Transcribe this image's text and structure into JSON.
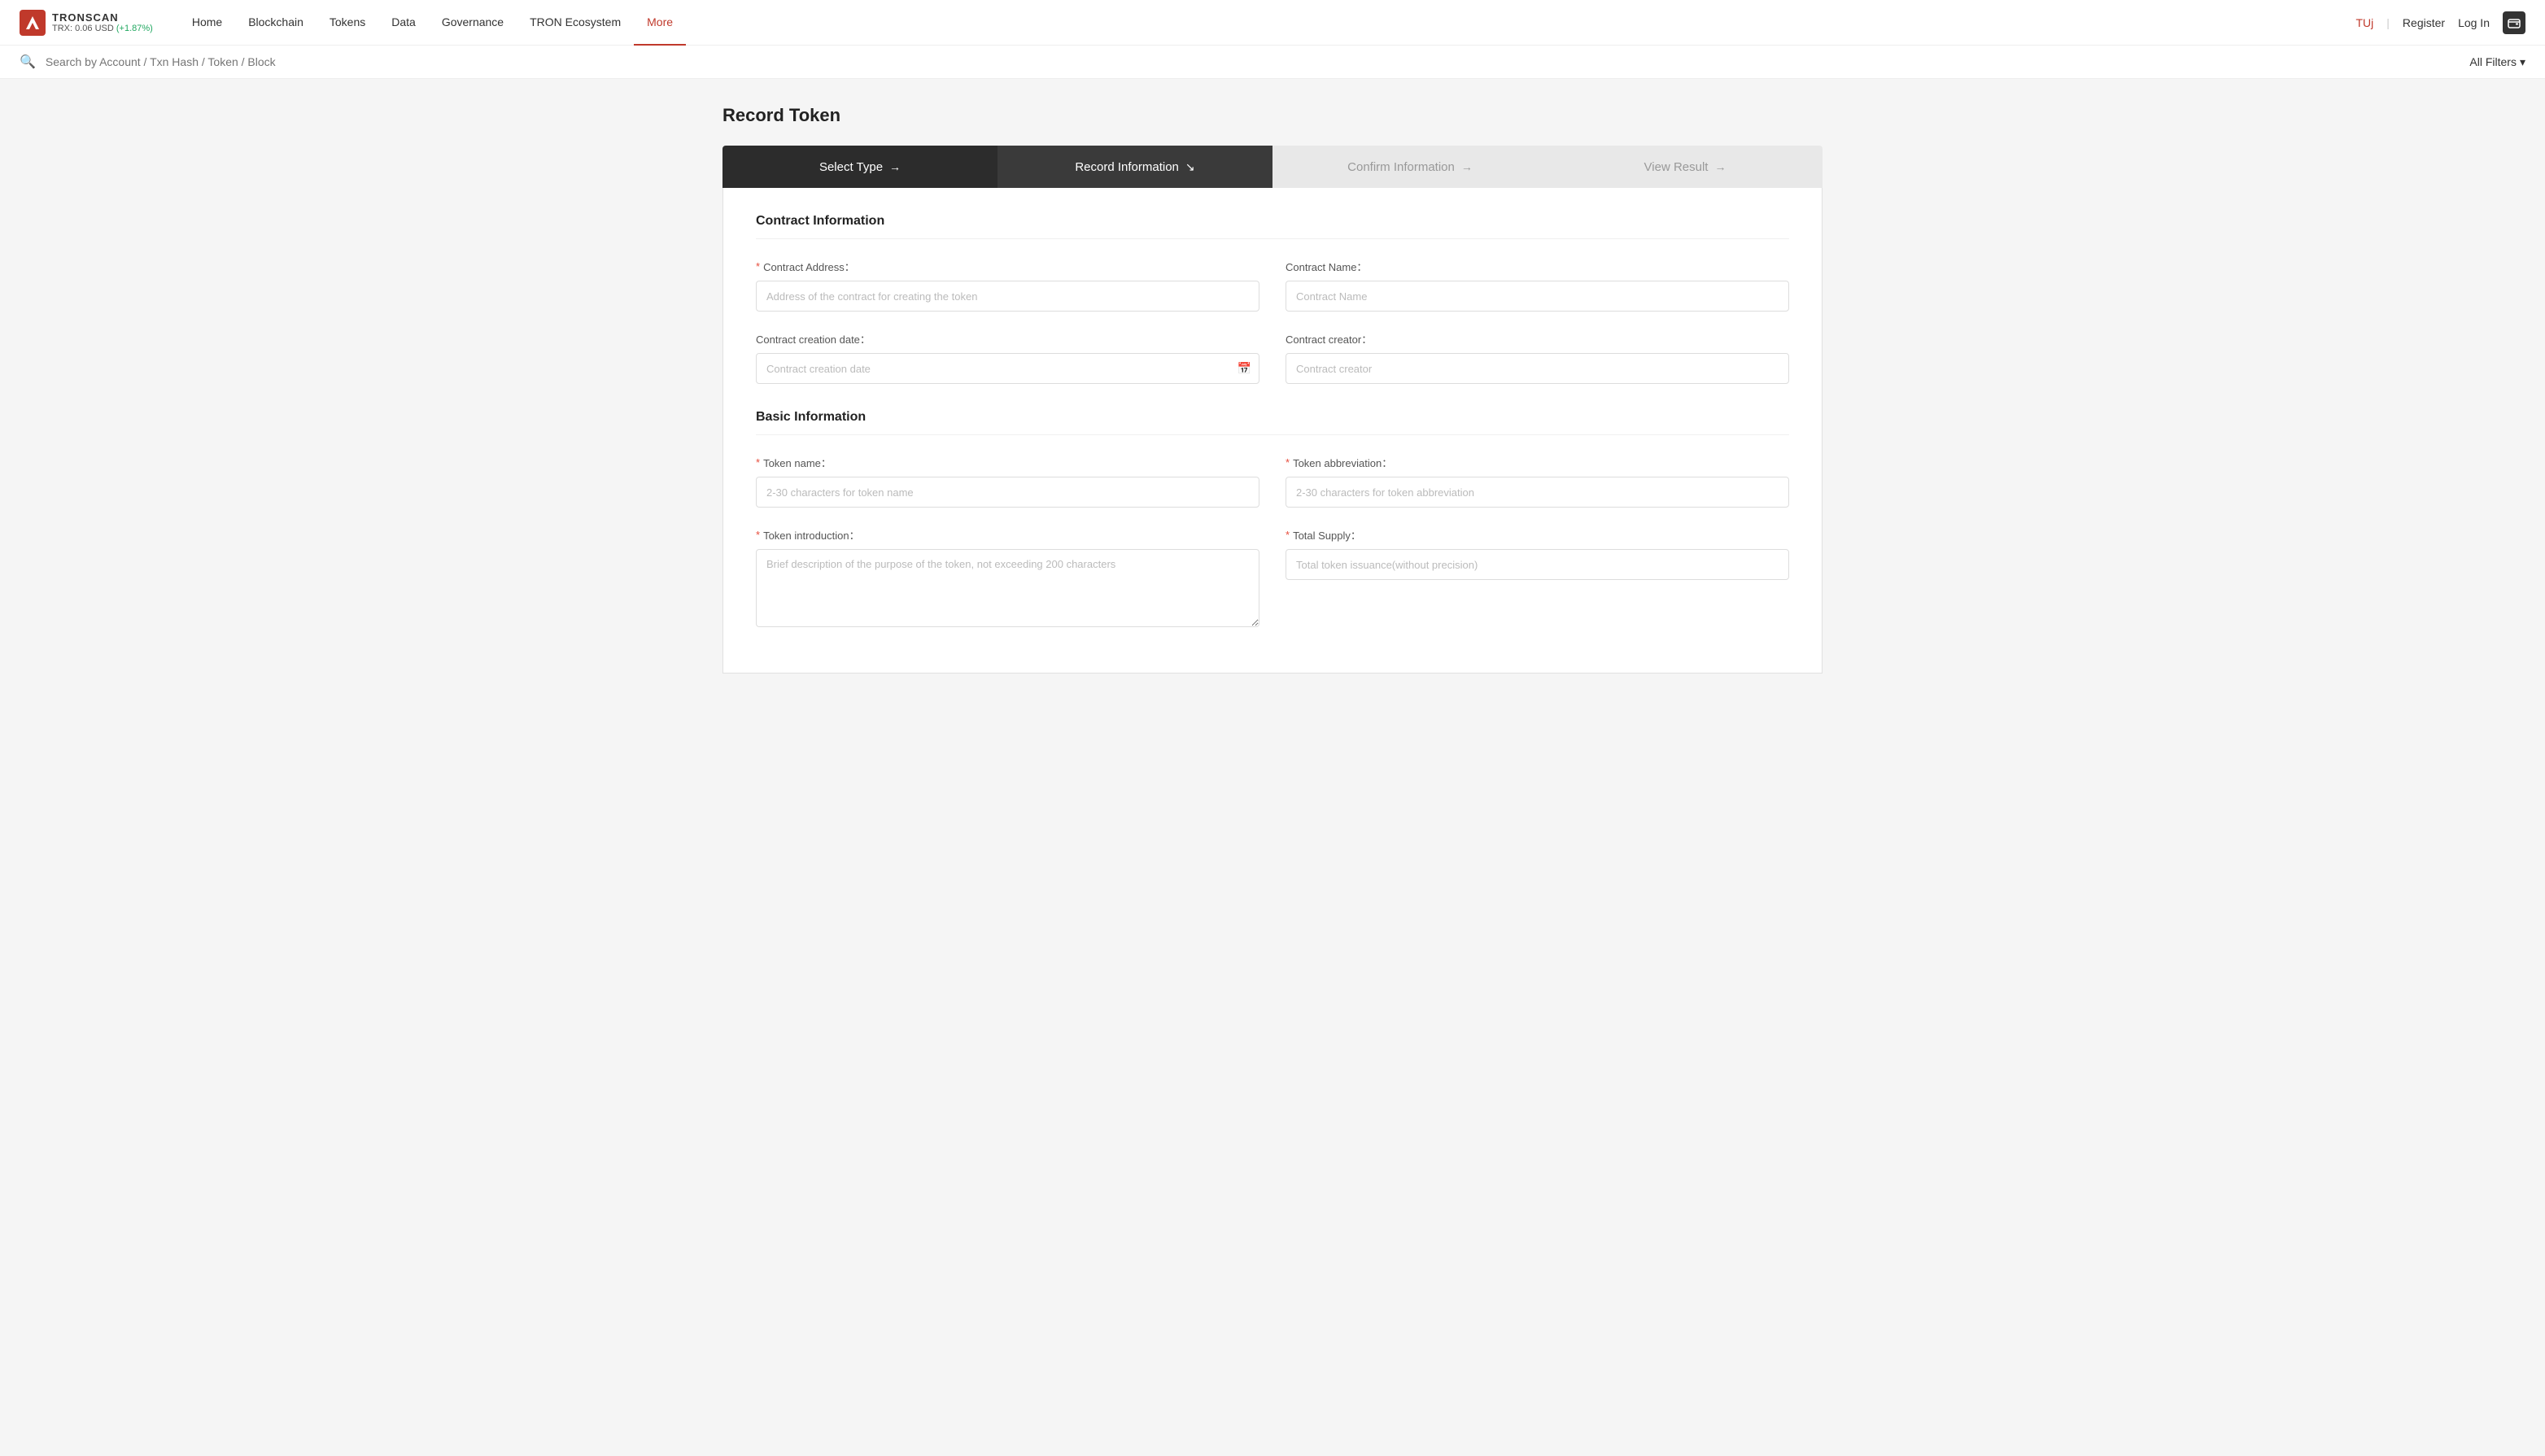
{
  "logo": {
    "name": "TRONSCAN",
    "price": "TRX: 0.06 USD",
    "price_change": "(+1.87%)"
  },
  "nav": {
    "links": [
      {
        "label": "Home",
        "active": false
      },
      {
        "label": "Blockchain",
        "active": false
      },
      {
        "label": "Tokens",
        "active": false
      },
      {
        "label": "Data",
        "active": false
      },
      {
        "label": "Governance",
        "active": false
      },
      {
        "label": "TRON Ecosystem",
        "active": false
      },
      {
        "label": "More",
        "active": true
      }
    ],
    "user": "TUj",
    "register": "Register",
    "login": "Log In",
    "divider": "|"
  },
  "search": {
    "placeholder": "Search by Account / Txn Hash / Token / Block",
    "filter_label": "All Filters"
  },
  "page": {
    "title": "Record Token"
  },
  "steps": [
    {
      "label": "Select Type",
      "arrow": "→",
      "state": "completed"
    },
    {
      "label": "Record Information",
      "arrow": "↘",
      "state": "active"
    },
    {
      "label": "Confirm Information",
      "arrow": "→",
      "state": "inactive"
    },
    {
      "label": "View Result",
      "arrow": "→",
      "state": "inactive"
    }
  ],
  "contract_info": {
    "section_title": "Contract Information",
    "contract_address_label": "Contract Address：",
    "contract_address_required": true,
    "contract_address_placeholder": "Address of the contract for creating the token",
    "contract_name_label": "Contract Name：",
    "contract_name_required": false,
    "contract_name_placeholder": "Contract Name",
    "creation_date_label": "Contract creation date：",
    "creation_date_required": false,
    "creation_date_placeholder": "Contract creation date",
    "contract_creator_label": "Contract creator：",
    "contract_creator_required": false,
    "contract_creator_placeholder": "Contract creator"
  },
  "basic_info": {
    "section_title": "Basic Information",
    "token_name_label": "Token name：",
    "token_name_required": true,
    "token_name_placeholder": "2-30 characters for token name",
    "token_abbreviation_label": "Token abbreviation：",
    "token_abbreviation_required": true,
    "token_abbreviation_placeholder": "2-30 characters for token abbreviation",
    "token_introduction_label": "Token introduction：",
    "token_introduction_required": true,
    "token_introduction_placeholder": "Brief description of the purpose of the token, not exceeding 200 characters",
    "total_supply_label": "Total Supply：",
    "total_supply_required": true,
    "total_supply_placeholder": "Total token issuance(without precision)"
  }
}
